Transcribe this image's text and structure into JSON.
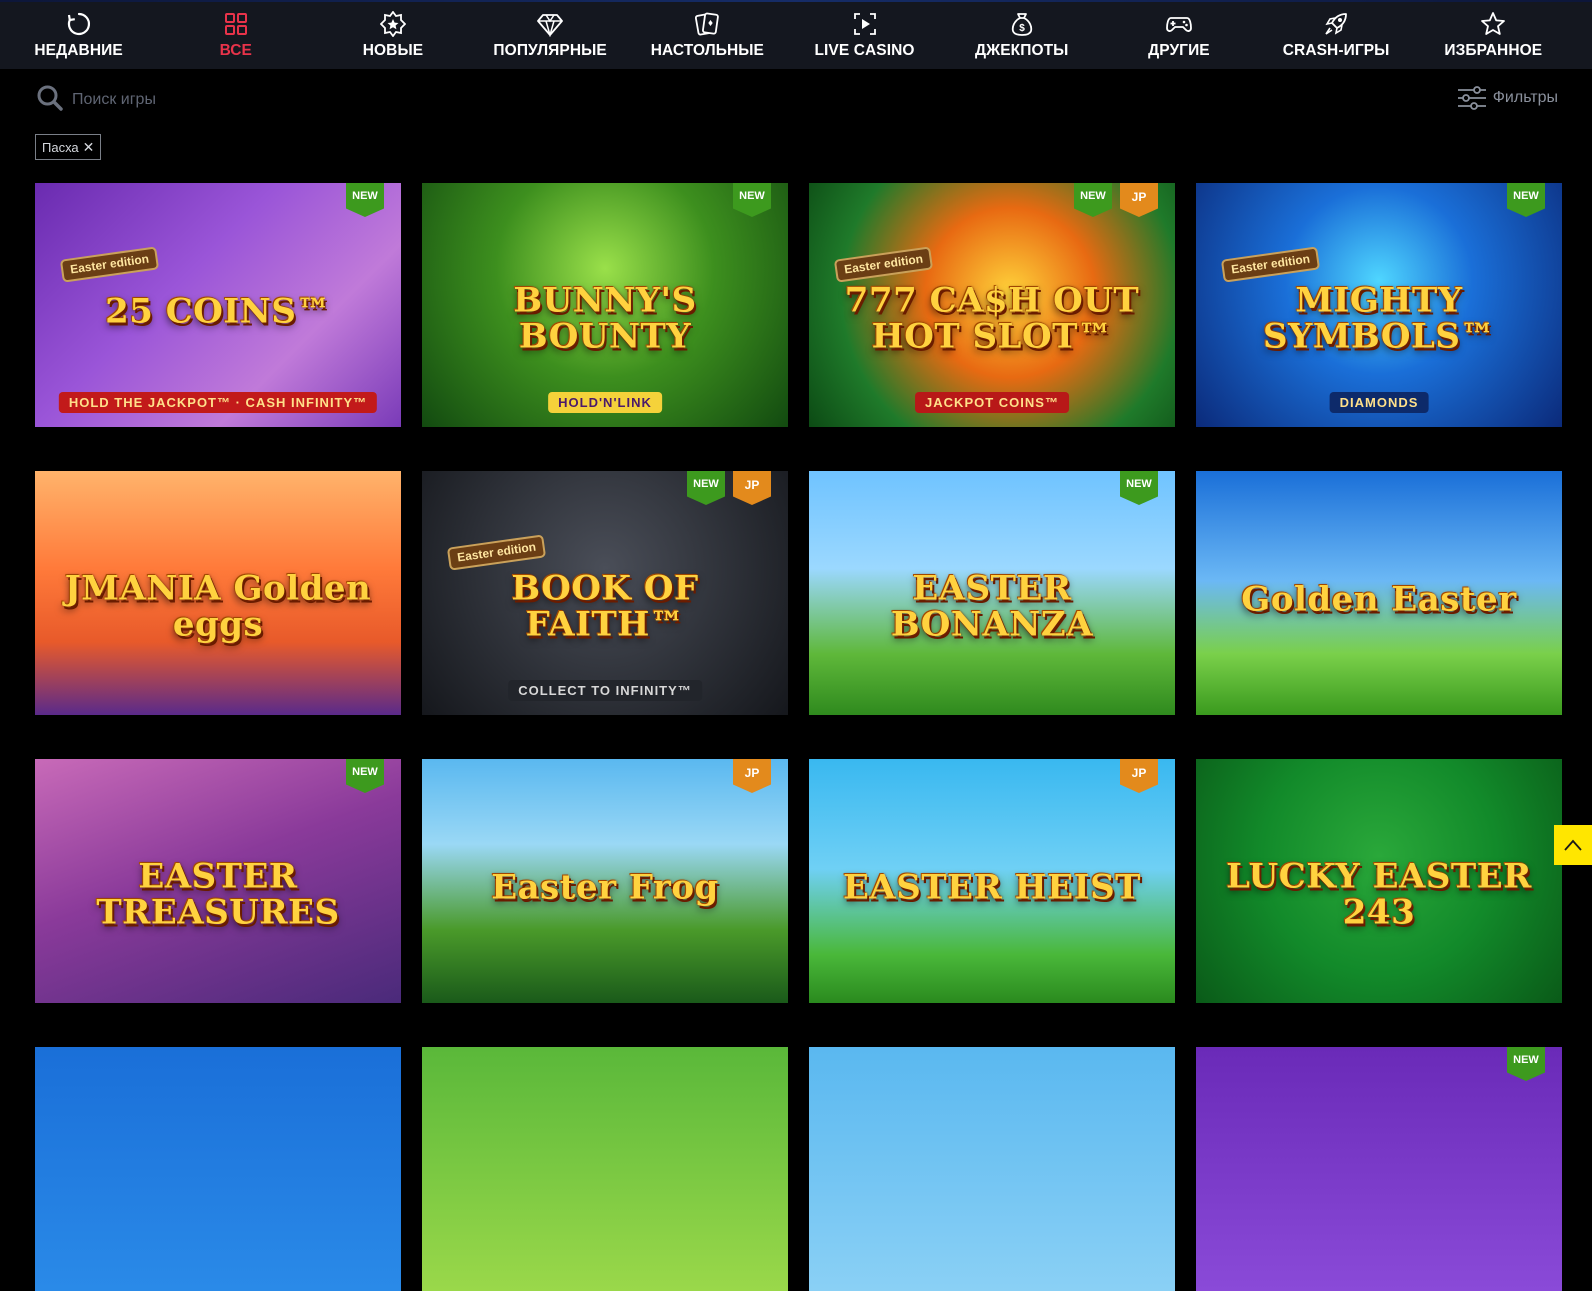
{
  "nav": {
    "tabs": [
      {
        "label": "НЕДАВНИЕ",
        "icon": "recent-icon",
        "active": false
      },
      {
        "label": "ВСЕ",
        "icon": "grid-icon",
        "active": true
      },
      {
        "label": "НОВЫЕ",
        "icon": "new-badge-icon",
        "active": false
      },
      {
        "label": "ПОПУЛЯРНЫЕ",
        "icon": "diamond-icon",
        "active": false
      },
      {
        "label": "НАСТОЛЬНЫЕ",
        "icon": "cards-icon",
        "active": false
      },
      {
        "label": "LIVE CASINO",
        "icon": "live-icon",
        "active": false
      },
      {
        "label": "ДЖЕКПОТЫ",
        "icon": "money-bag-icon",
        "active": false
      },
      {
        "label": "ДРУГИЕ",
        "icon": "gamepad-icon",
        "active": false
      },
      {
        "label": "CRASH-ИГРЫ",
        "icon": "rocket-icon",
        "active": false
      },
      {
        "label": "ИЗБРАННОЕ",
        "icon": "star-icon",
        "active": false
      }
    ],
    "active_color": "#e8334a"
  },
  "search": {
    "placeholder": "Поиск игры",
    "value": ""
  },
  "filters": {
    "label": "Фильтры"
  },
  "active_tag": {
    "label": "Пасха"
  },
  "games": [
    {
      "title": "25 COINS™",
      "subtitle": "HOLD THE JACKPOT™ · CASH INFINITY™",
      "edition": "Easter edition",
      "badges": [
        "NEW"
      ],
      "bg": "linear-gradient(135deg,#6a2bb0 0%,#9a55d8 40%,#c07ad9 70%,#7a3bb8 100%)",
      "sub_bg": "#c21a1a",
      "sub_color": "#ffe08a"
    },
    {
      "title": "BUNNY'S BOUNTY",
      "subtitle": "HOLD'N'LINK",
      "edition": "",
      "badges": [
        "NEW"
      ],
      "bg": "radial-gradient(circle at 50% 35%,#9ae04a 0%,#3d8f1e 45%,#124a10 100%)",
      "sub_bg": "#f5d23a",
      "sub_color": "#4b1a6a"
    },
    {
      "title": "777 CA$H OUT HOT SLOT™",
      "subtitle": "JACKPOT COINS™",
      "edition": "Easter edition",
      "badges": [
        "NEW",
        "JP"
      ],
      "bg": "radial-gradient(circle at 55% 45%,#ffd23a 0%,#e86a12 35%,#1f7a2a 70%,#0c4a14 100%)",
      "sub_bg": "#b81818",
      "sub_color": "#ffe08a"
    },
    {
      "title": "MIGHTY SYMBOLS™",
      "subtitle": "DIAMONDS",
      "edition": "Easter edition",
      "badges": [
        "NEW"
      ],
      "bg": "radial-gradient(circle at 50% 40%,#4fd6ff 0%,#1a6fd8 40%,#0b2a7a 100%)",
      "sub_bg": "#0d2a6a",
      "sub_color": "#ffe08a"
    },
    {
      "title": "JMANIA Golden eggs",
      "subtitle": "",
      "edition": "",
      "badges": [],
      "bg": "linear-gradient(180deg,#ffb36b 0%,#ff7a3a 40%,#e85a2a 70%,#5a2a8a 100%)",
      "sub_bg": "transparent",
      "sub_color": "#ffffff"
    },
    {
      "title": "BOOK OF FAITH™",
      "subtitle": "COLLECT TO INFINITY™",
      "edition": "Easter edition",
      "badges": [
        "NEW",
        "JP"
      ],
      "bg": "radial-gradient(circle at 50% 40%,#4a4e58 0%,#2a2d34 60%,#15171c 100%)",
      "sub_bg": "#22252b",
      "sub_color": "#d8d8d8"
    },
    {
      "title": "EASTER BONANZA",
      "subtitle": "",
      "edition": "",
      "badges": [
        "NEW"
      ],
      "bg": "linear-gradient(180deg,#6fc3ff 0%,#9bd8ff 40%,#5fb83a 75%,#2f8a1e 100%)",
      "sub_bg": "transparent",
      "sub_color": "#ffffff"
    },
    {
      "title": "Golden Easter",
      "subtitle": "",
      "edition": "",
      "badges": [],
      "bg": "linear-gradient(180deg,#1a6fd8 0%,#6bb8f5 45%,#7ad04a 75%,#3a9a1e 100%)",
      "sub_bg": "transparent",
      "sub_color": "#ffffff"
    },
    {
      "title": "EASTER TREASURES",
      "subtitle": "",
      "edition": "",
      "badges": [
        "NEW"
      ],
      "bg": "linear-gradient(160deg,#c86ab8 0%,#8a3a9a 45%,#4a2a7a 100%)",
      "sub_bg": "transparent",
      "sub_color": "#ffffff"
    },
    {
      "title": "Easter Frog",
      "subtitle": "",
      "edition": "",
      "badges": [
        "JP"
      ],
      "bg": "linear-gradient(180deg,#5ab8f0 0%,#9ad8f5 35%,#4a9a2a 70%,#1a5a1a 100%)",
      "sub_bg": "transparent",
      "sub_color": "#ffffff"
    },
    {
      "title": "EASTER HEIST",
      "subtitle": "",
      "edition": "",
      "badges": [
        "JP"
      ],
      "bg": "linear-gradient(180deg,#39b8f0 0%,#6fd0f5 45%,#4ab83a 80%,#2a8a1e 100%)",
      "sub_bg": "transparent",
      "sub_color": "#ffffff"
    },
    {
      "title": "LUCKY EASTER 243",
      "subtitle": "",
      "edition": "",
      "badges": [],
      "bg": "radial-gradient(circle at 50% 40%,#2aa83a 0%,#128a2a 50%,#0a5a18 100%)",
      "sub_bg": "transparent",
      "sub_color": "#ffffff"
    },
    {
      "title": "",
      "subtitle": "",
      "edition": "",
      "badges": [],
      "bg": "linear-gradient(180deg,#1a6fd8 0%,#2a8ae8 100%)",
      "sub_bg": "transparent",
      "sub_color": "#ffffff"
    },
    {
      "title": "",
      "subtitle": "",
      "edition": "",
      "badges": [],
      "bg": "linear-gradient(180deg,#5ab83a 0%,#9ad84a 100%)",
      "sub_bg": "transparent",
      "sub_color": "#ffffff"
    },
    {
      "title": "",
      "subtitle": "",
      "edition": "",
      "badges": [],
      "bg": "linear-gradient(180deg,#5ab8f0 0%,#8ad0f5 100%)",
      "sub_bg": "transparent",
      "sub_color": "#ffffff"
    },
    {
      "title": "",
      "subtitle": "",
      "edition": "",
      "badges": [
        "NEW"
      ],
      "bg": "linear-gradient(180deg,#6a2ab8 0%,#8a4ad8 100%)",
      "sub_bg": "transparent",
      "sub_color": "#ffffff"
    }
  ],
  "badge_colors": {
    "NEW": "#3d9a1e",
    "JP": "#e38a1c"
  },
  "scroll_top": {
    "icon": "chevron-up-icon",
    "color": "#ffe600"
  }
}
